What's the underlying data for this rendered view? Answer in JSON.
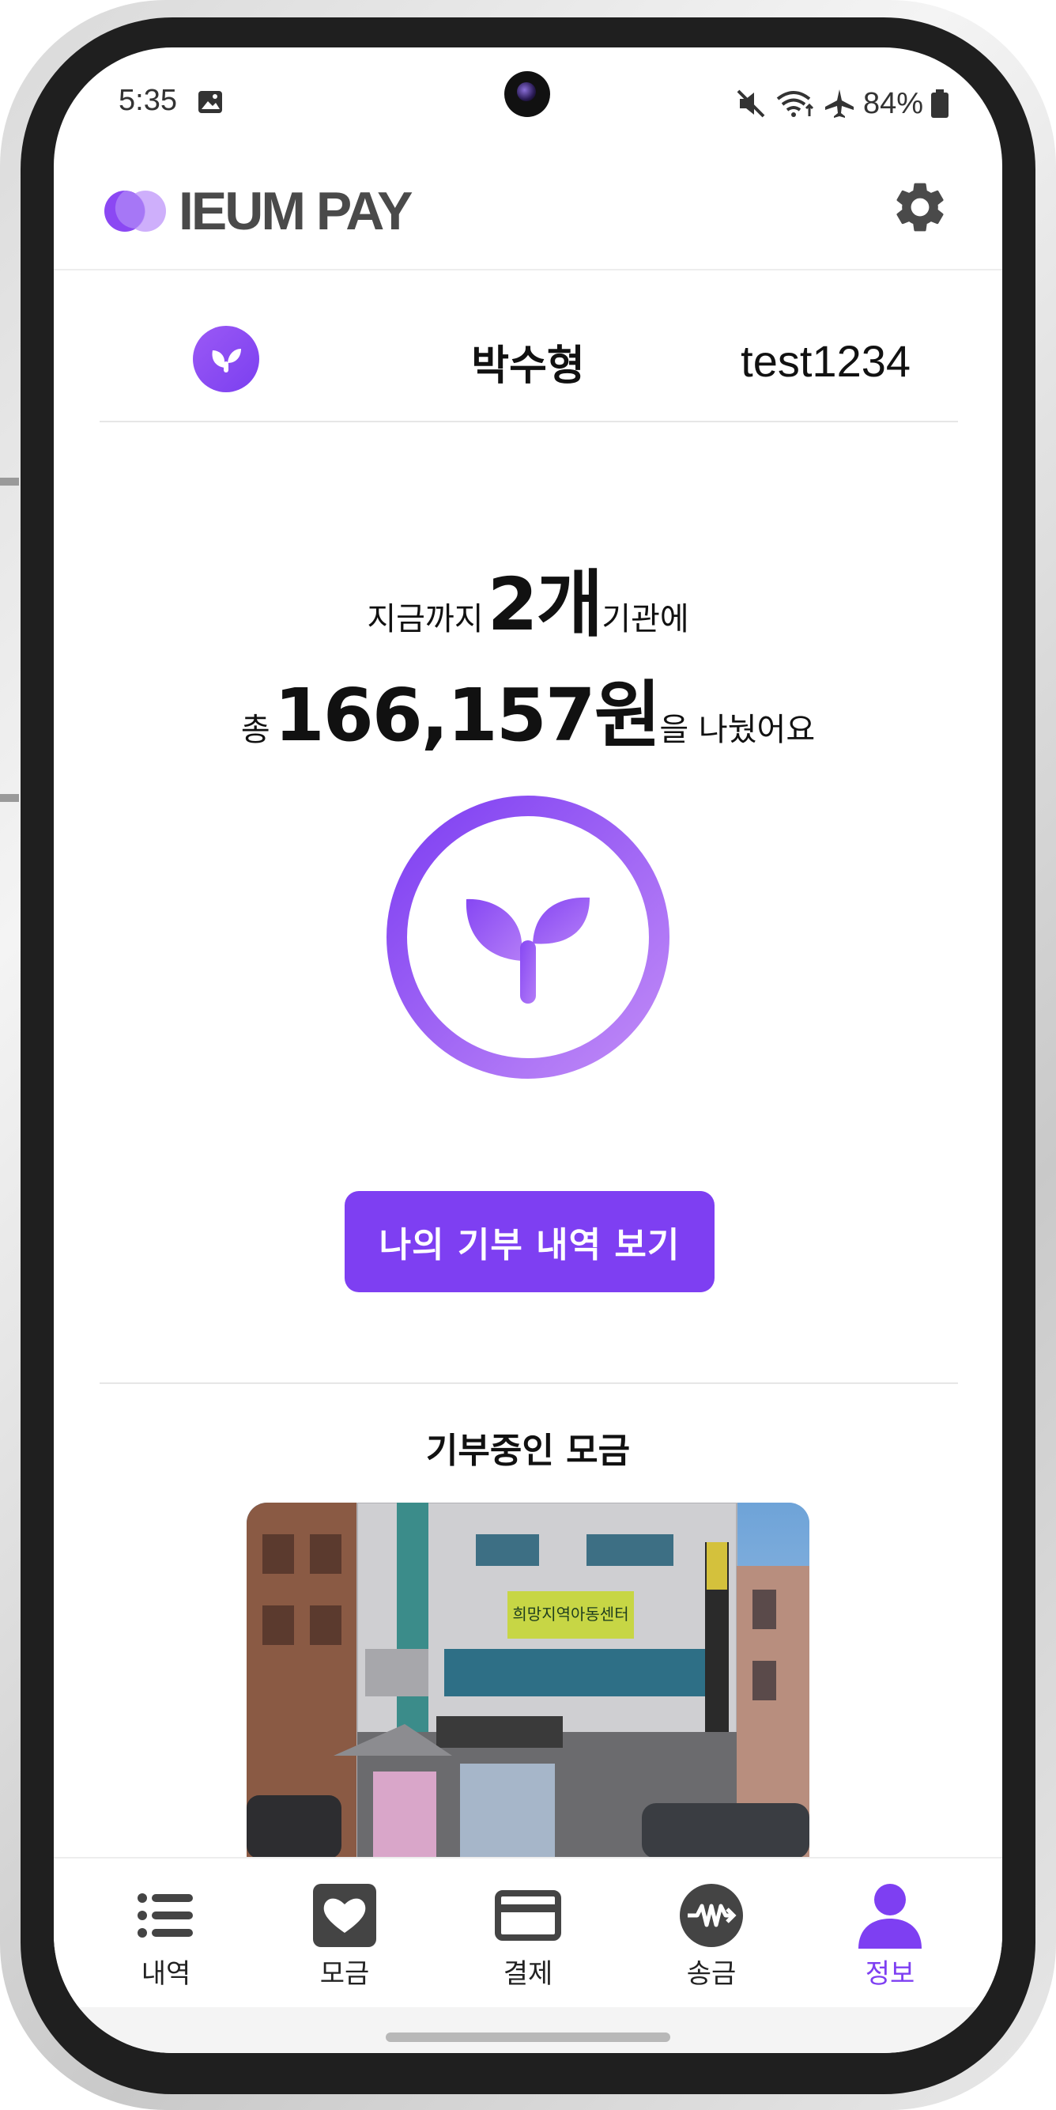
{
  "status_bar": {
    "time": "5:35",
    "battery": "84%"
  },
  "header": {
    "brand": "IEUM PAY",
    "settings_icon": "gear-icon"
  },
  "user": {
    "name": "박수형",
    "id": "test1234"
  },
  "summary": {
    "prefix1": "지금까지",
    "org_count": "2개",
    "suffix1": "기관에",
    "prefix2": "총",
    "amount": "166,157원",
    "suffix2": "을 나눴어요"
  },
  "actions": {
    "history_button": "나의 기부 내역 보기"
  },
  "fundraising": {
    "section_title": "기부중인 모금",
    "photo_sign": "희망지역아동센터"
  },
  "bottom_nav": [
    {
      "label": "내역",
      "icon": "list-icon",
      "active": false
    },
    {
      "label": "모금",
      "icon": "heart-icon",
      "active": false
    },
    {
      "label": "결제",
      "icon": "card-icon",
      "active": false
    },
    {
      "label": "송금",
      "icon": "transfer-icon",
      "active": false
    },
    {
      "label": "정보",
      "icon": "person-icon",
      "active": true
    }
  ],
  "colors": {
    "accent": "#7e3ff2",
    "accent_light": "#b98af7"
  }
}
